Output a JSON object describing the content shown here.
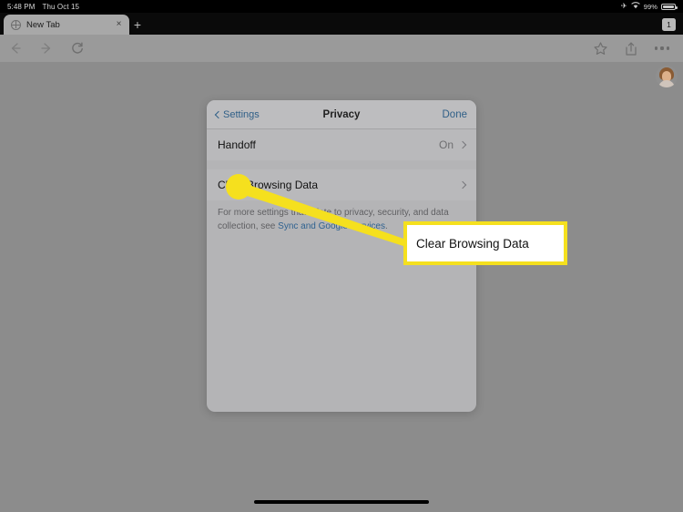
{
  "status_bar": {
    "time": "5:48 PM",
    "date": "Thu Oct 15",
    "airplane_icon": "airplane-icon",
    "wifi_icon": "wifi-icon",
    "battery_percent": "99%",
    "battery_icon": "battery-icon"
  },
  "tab_strip": {
    "tab_title": "New Tab",
    "favicon": "globe-icon",
    "close_icon": "×",
    "new_tab_icon": "+",
    "tab_count": "1"
  },
  "toolbar": {
    "back_icon": "back-arrow-icon",
    "forward_icon": "forward-arrow-icon",
    "reload_icon": "reload-icon",
    "bookmark_icon": "star-icon",
    "share_icon": "share-icon",
    "menu_icon": "three-dots-icon"
  },
  "dialog": {
    "back_label": "Settings",
    "title": "Privacy",
    "done_label": "Done",
    "rows": [
      {
        "label": "Handoff",
        "value": "On"
      },
      {
        "label": "Clear Browsing Data",
        "value": ""
      }
    ],
    "footer": {
      "text_before": "For more settings that relate to privacy, security, and data collection, see ",
      "link": "Sync and Google Services",
      "text_after": "."
    }
  },
  "annotation": {
    "callout_label": "Clear Browsing Data",
    "highlight_color": "#f5e01e",
    "callout_background": "#ffffff"
  },
  "colors": {
    "page_background": "#8c8c8c",
    "dialog_background": "#b4b4b6",
    "link_blue": "#2f5f87",
    "toolbar_background": "#9a9a9a"
  }
}
